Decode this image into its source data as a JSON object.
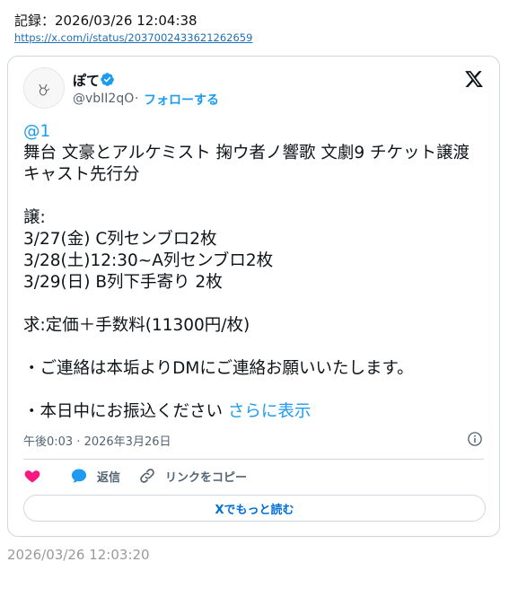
{
  "record": {
    "label": "記録：2026/03/26 12:04:38",
    "url": "https://x.com/i/status/2037002433621262659"
  },
  "tweet": {
    "author_name": "ぽて",
    "handle": "@vbII2qO",
    "separator": "·",
    "follow_label": "フォローする",
    "mention": "@1",
    "body": "\n舞台 文豪とアルケミスト 掬ウ者ノ響歌 文劇9 チケット譲渡 キャスト先行分\n\n譲:\n3/27(金) C列センブロ2枚\n3/28(土)12:30~A列センブロ2枚\n3/29(日) B列下手寄り 2枚\n\n求:定価＋手数料(11300円/枚)\n\n・ご連絡は本垢よりDMにご連絡お願いいたします。\n\n・本日中にお振込ください ",
    "show_more": "さらに表示",
    "timestamp": "午後0:03 · 2026年3月26日"
  },
  "actions": {
    "reply_label": "返信",
    "copy_link_label": "リンクをコピー",
    "read_more_label": "Xでもっと読む"
  },
  "footer": {
    "captured_time": "2026/03/26 12:03:20"
  },
  "colors": {
    "accent": "#1d9bf0",
    "like": "#f91880",
    "text": "#0f1419",
    "muted": "#536471",
    "border": "#cfd9de"
  },
  "icons": {
    "verified": "verified-badge-icon",
    "x_logo": "x-logo-icon",
    "info": "info-icon",
    "like": "heart-icon",
    "reply": "reply-bubble-icon",
    "link": "link-icon"
  }
}
